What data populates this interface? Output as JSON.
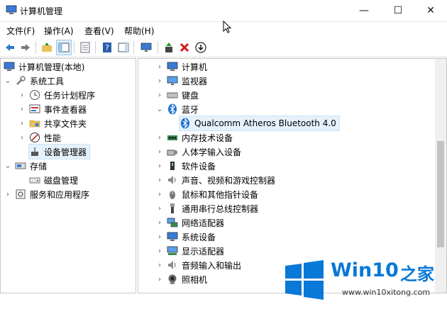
{
  "window": {
    "title": "计算机管理",
    "minimize": "—",
    "maximize": "☐",
    "close": "✕"
  },
  "menu": [
    "文件(F)",
    "操作(A)",
    "查看(V)",
    "帮助(H)"
  ],
  "tree": {
    "root": "计算机管理(本地)",
    "system_tools": "系统工具",
    "task_scheduler": "任务计划程序",
    "event_viewer": "事件查看器",
    "shared_folders": "共享文件夹",
    "performance": "性能",
    "device_manager": "设备管理器",
    "storage": "存储",
    "disk_management": "磁盘管理",
    "services": "服务和应用程序"
  },
  "devices": {
    "computer": "计算机",
    "monitors": "监视器",
    "keyboards": "键盘",
    "bluetooth": "蓝牙",
    "bt_adapter": "Qualcomm Atheros Bluetooth 4.0",
    "memory_tech": "内存技术设备",
    "hid": "人体学输入设备",
    "software_devices": "软件设备",
    "sound": "声音、视频和游戏控制器",
    "mice": "鼠标和其他指针设备",
    "usb": "通用串行总线控制器",
    "network": "网络适配器",
    "system_devices": "系统设备",
    "display": "显示适配器",
    "audio_io": "音频输入和输出",
    "cameras": "照相机"
  },
  "watermark": {
    "brand": "Win10",
    "brand_suffix": "之家",
    "url": "www.win10xitong.com"
  },
  "colors": {
    "accent": "#0a78d7",
    "selected": "#e5f1fb"
  }
}
